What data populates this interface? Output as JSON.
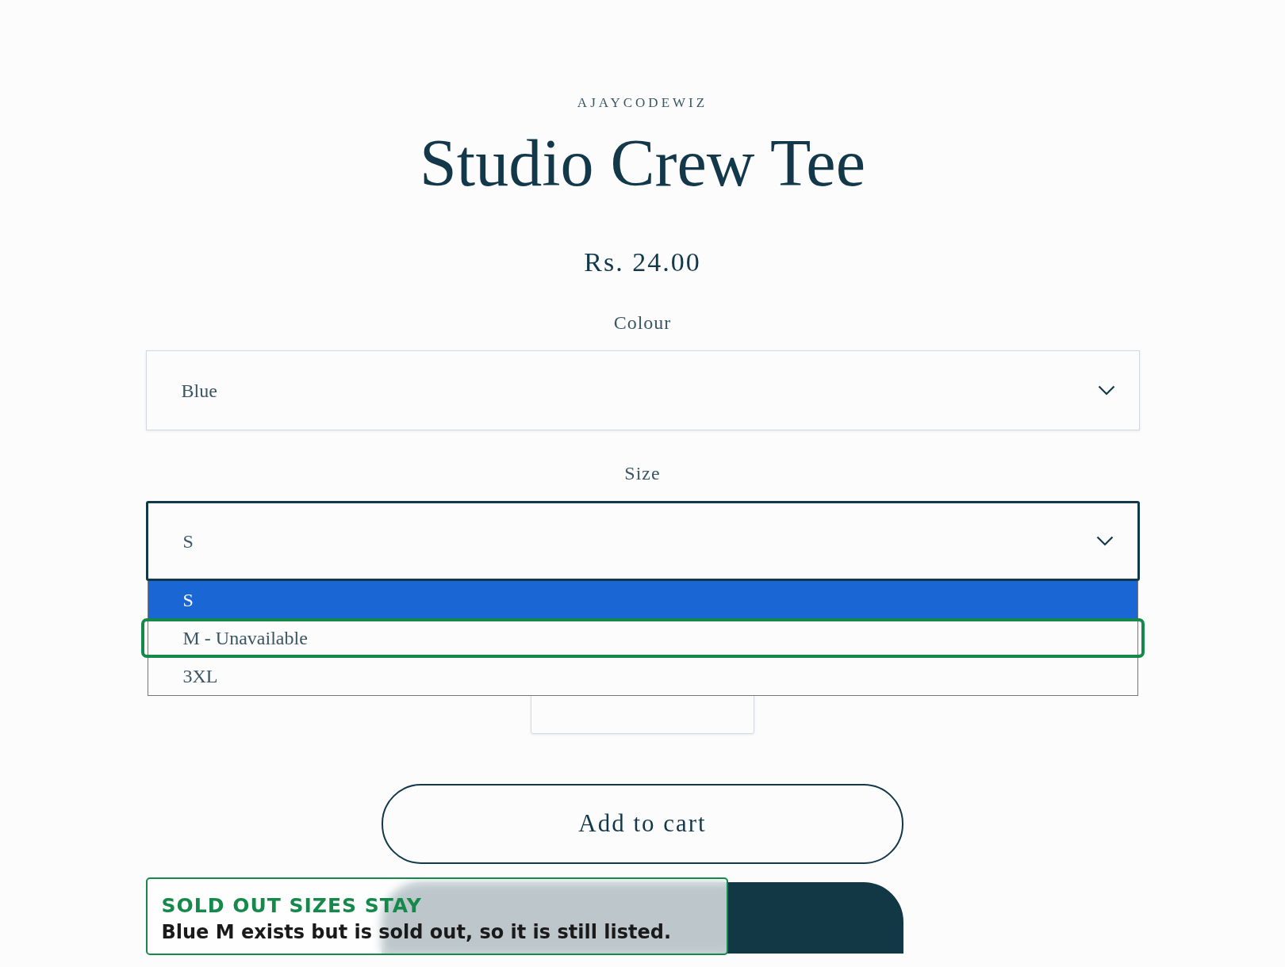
{
  "vendor": "AJAYCODEWIZ",
  "product_title": "Studio Crew Tee",
  "price": "Rs. 24.00",
  "colour": {
    "label": "Colour",
    "value": "Blue",
    "open": false
  },
  "size": {
    "label": "Size",
    "value": "S",
    "open": true,
    "options": [
      {
        "label": "S",
        "selected": true,
        "highlighted": false
      },
      {
        "label": "M - Unavailable",
        "selected": false,
        "highlighted": true
      },
      {
        "label": "3XL",
        "selected": false,
        "highlighted": false
      }
    ]
  },
  "buttons": [
    {
      "kind": "outline",
      "label": "Add to cart"
    },
    {
      "kind": "solid"
    }
  ],
  "note": {
    "title": "SOLD OUT SIZES STAY",
    "text": "Blue M exists but is sold out, so it is still listed."
  }
}
